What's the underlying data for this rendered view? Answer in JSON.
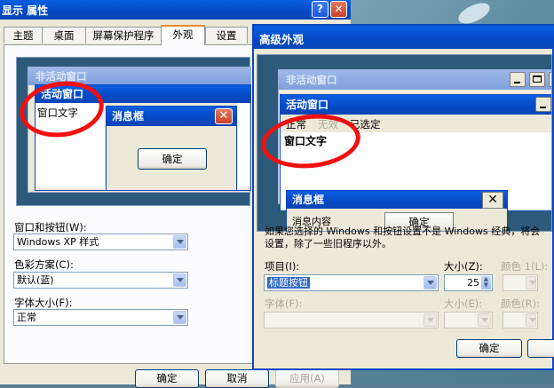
{
  "display_props": {
    "title": "显示 属性",
    "tabs": [
      "主题",
      "桌面",
      "屏幕保护程序",
      "外观",
      "设置"
    ],
    "active_tab": 3,
    "preview": {
      "inactive_window": "非活动窗口",
      "active_window": "活动窗口",
      "window_text": "窗口文字",
      "message_box": "消息框",
      "ok": "确定"
    },
    "fields": {
      "windows_buttons_label": "窗口和按钮(W):",
      "windows_buttons_value": "Windows XP 样式",
      "color_scheme_label": "色彩方案(C):",
      "color_scheme_value": "默认(蓝)",
      "font_size_label": "字体大小(F):",
      "font_size_value": "正常"
    },
    "buttons": {
      "ok": "确定",
      "cancel": "取消",
      "apply": "应用(A)"
    }
  },
  "advanced": {
    "title": "高级外观",
    "preview": {
      "inactive_window": "非活动窗口",
      "active_window": "活动窗口",
      "menu_normal": "正常",
      "menu_disabled": "无效",
      "menu_selected": "已选定",
      "window_text": "窗口文字",
      "message_box": "消息框",
      "message_text": "消息内容",
      "ok": "确定"
    },
    "note": "如果您选择的 Windows 和按钮设置不是 Windows 经典，将会",
    "note2": "设置，除了一些旧程序以外。",
    "item_label": "项目(I):",
    "item_value": "标题按钮",
    "size_label": "大小(Z):",
    "size_value": "25",
    "color1_label": "颜色 1(L):",
    "font_label": "字体(F):",
    "font_size_label": "大小(E):",
    "font_color_label": "颜色(R):",
    "ok": "确定"
  },
  "colors": {
    "title_blue": "#0548c4",
    "annotation_red": "#f01010"
  }
}
